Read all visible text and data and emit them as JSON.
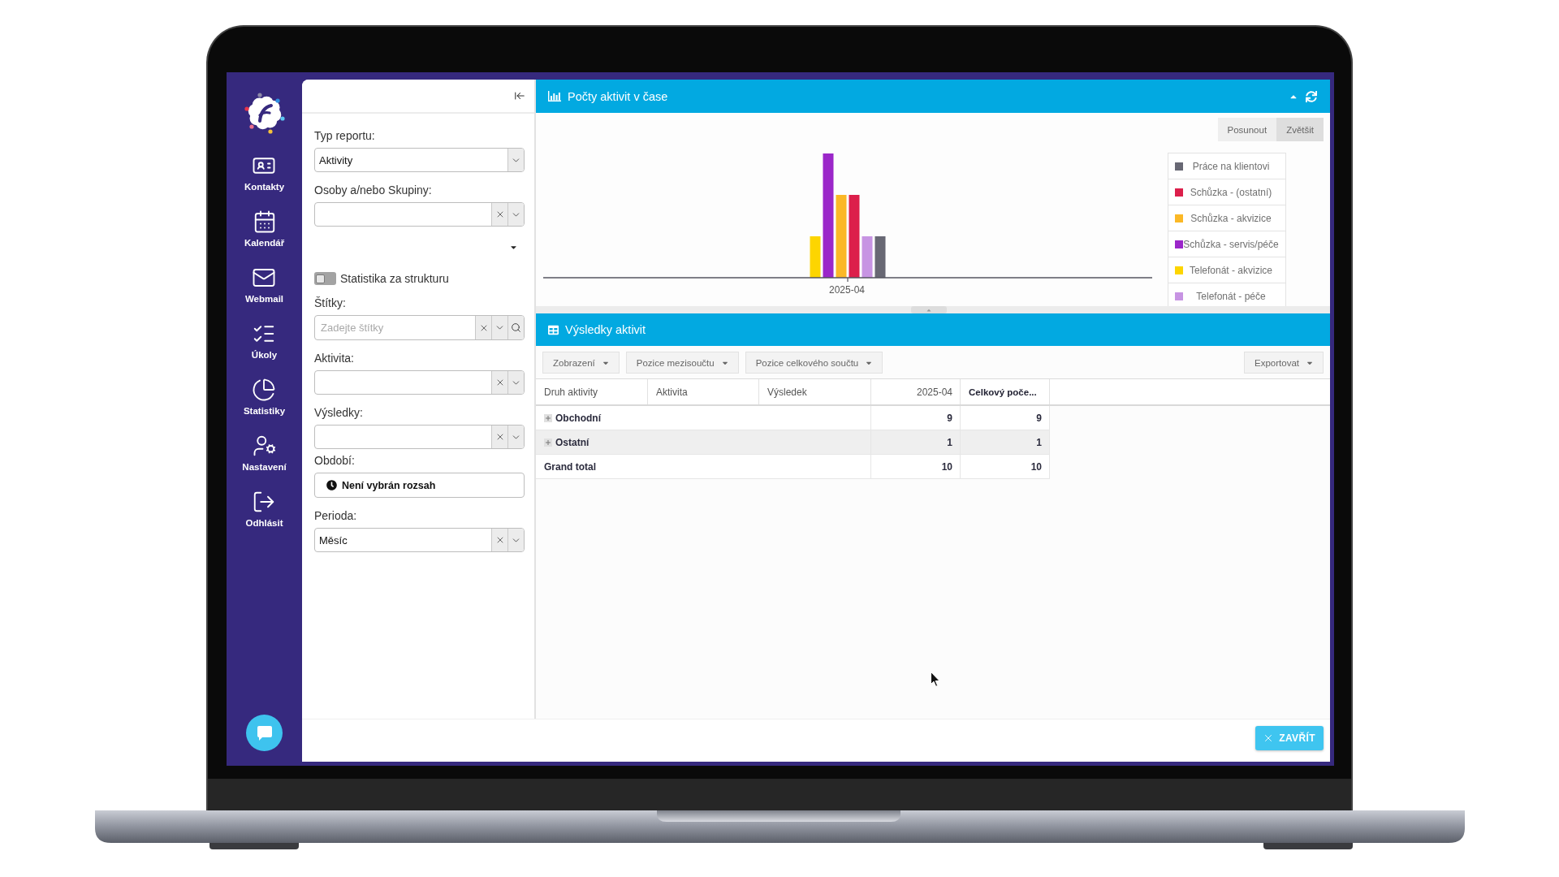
{
  "sidebar": {
    "items": [
      {
        "label": "Kontakty"
      },
      {
        "label": "Kalendář"
      },
      {
        "label": "Webmail"
      },
      {
        "label": "Úkoly"
      },
      {
        "label": "Statistiky"
      },
      {
        "label": "Nastavení"
      },
      {
        "label": "Odhlásit"
      }
    ]
  },
  "filter_panel": {
    "fields": [
      {
        "kind": "select",
        "label": "Typ reportu:",
        "value": "Aktivity",
        "clearable": false
      },
      {
        "kind": "select",
        "label": "Osoby a/nebo Skupiny:",
        "clearable": true
      },
      {
        "kind": "expander"
      },
      {
        "kind": "toggle",
        "label": "Statistika za strukturu",
        "on": false
      },
      {
        "kind": "tags",
        "label": "Štítky:",
        "placeholder": "Zadejte štítky"
      },
      {
        "kind": "select",
        "label": "Aktivita:",
        "clearable": true
      },
      {
        "kind": "select",
        "label": "Výsledky:",
        "clearable": true
      },
      {
        "kind": "daterange",
        "label": "Období:",
        "value": "Není vybrán rozsah"
      },
      {
        "kind": "select",
        "label": "Perioda:",
        "value": "Měsíc",
        "clearable": true
      }
    ]
  },
  "chart_panel": {
    "title": "Počty aktivit v čase",
    "modes": [
      {
        "label": "Posunout",
        "selected": false
      },
      {
        "label": "Zvětšit",
        "selected": true
      }
    ],
    "category_label": "2025-04",
    "legend": [
      {
        "label": "Práce na klientovi",
        "color": "#686874"
      },
      {
        "label": "Schůzka - (ostatní)",
        "color": "#dc1f4b"
      },
      {
        "label": "Schůzka - akvizice",
        "color": "#fbb826"
      },
      {
        "label": "Schůzka - servis/péče",
        "color": "#9b27c9"
      },
      {
        "label": "Telefonát - akvizice",
        "color": "#fdd500"
      },
      {
        "label": "Telefonát - péče",
        "color": "#c794e3"
      }
    ]
  },
  "results_panel": {
    "title": "Výsledky aktivit",
    "toolbar": [
      "Zobrazení",
      "Pozice mezisoučtu",
      "Pozice celkového součtu"
    ],
    "export_button": "Exportovat",
    "table": {
      "columns": [
        {
          "label": "Druh aktivity",
          "kind": "dimension"
        },
        {
          "label": "Aktivita",
          "kind": "dimension"
        },
        {
          "label": "Výsledek",
          "kind": "dimension"
        },
        {
          "label": "2025-04",
          "kind": "value"
        },
        {
          "label": "Celkový poče...",
          "kind": "total"
        }
      ],
      "rows": [
        {
          "kind": "group",
          "label": "Obchodní",
          "expanded": false,
          "values": [
            "9",
            "9"
          ]
        },
        {
          "kind": "group",
          "label": "Ostatní",
          "expanded": false,
          "values": [
            "1",
            "1"
          ]
        },
        {
          "kind": "total",
          "label": "Grand total",
          "values": [
            "10",
            "10"
          ]
        }
      ]
    }
  },
  "footer": {
    "close_button": "ZAVŘÍT"
  }
}
